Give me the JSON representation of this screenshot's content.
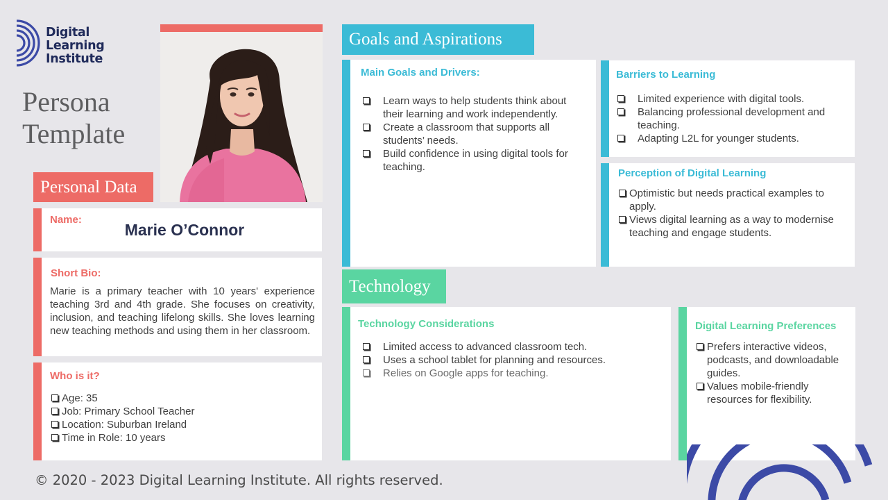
{
  "brand": {
    "logo_line1": "Digital",
    "logo_line2": "Learning",
    "logo_line3": "Institute"
  },
  "page_title": "Persona Template",
  "sections": {
    "personal": "Personal Data",
    "goals": "Goals and Aspirations",
    "technology": "Technology"
  },
  "personal": {
    "name_label": "Name:",
    "name": "Marie O’Connor",
    "bio_label": "Short Bio:",
    "bio": "Marie is a primary teacher with 10 years' experience teaching 3rd and 4th grade. She focuses on creativity, inclusion, and teaching lifelong skills. She loves learning new teaching methods and using them in her classroom.",
    "who_label": "Who is it?",
    "who": [
      "Age: 35",
      "Job: Primary School Teacher",
      "Location: Suburban Ireland",
      "Time in Role: 10 years"
    ]
  },
  "goals": {
    "title": "Main Goals and Drivers:",
    "items": [
      "Learn ways to help students think about their learning and work independently.",
      "Create a classroom that supports all students’ needs.",
      "Build confidence in using digital tools for teaching."
    ]
  },
  "barriers": {
    "title": "Barriers to Learning",
    "items": [
      "Limited experience with digital tools.",
      "Balancing professional development and teaching.",
      "Adapting L2L for younger students."
    ]
  },
  "perception": {
    "title": "Perception of Digital Learning",
    "items": [
      "Optimistic but needs practical examples to apply.",
      "Views digital learning as a way to modernise teaching and engage students."
    ]
  },
  "tech": {
    "title": "Technology Considerations",
    "items": [
      "Limited access to advanced classroom tech.",
      "Uses a school tablet for planning and resources.",
      "Relies on Google apps for teaching."
    ]
  },
  "prefs": {
    "title": "Digital Learning Preferences",
    "items": [
      "Prefers interactive videos, podcasts, and downloadable guides.",
      "Values mobile-friendly resources for flexibility."
    ]
  },
  "footer": {
    "copyright": "© 2020 - 2023 Digital Learning Institute. All rights reserved."
  },
  "colors": {
    "personal_accent": "#ed6b66",
    "goals_accent": "#3bbbd6",
    "tech_accent": "#5ad5a1",
    "brand_navy": "#2f3d8f"
  }
}
